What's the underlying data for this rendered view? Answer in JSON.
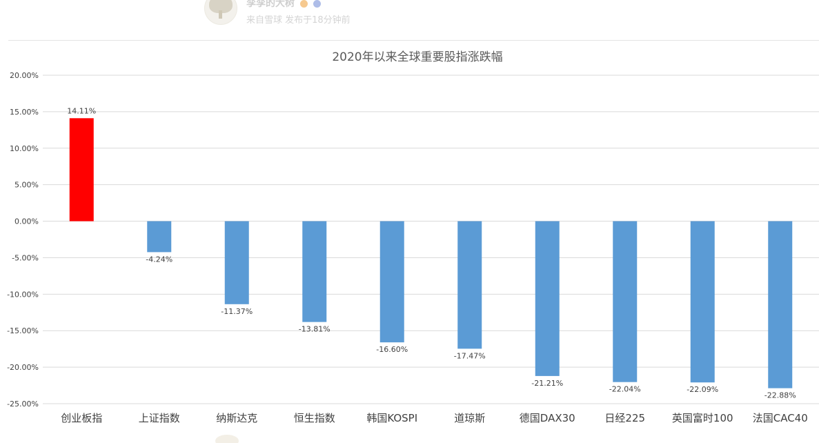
{
  "post": {
    "author": "孪孪的大树",
    "meta": "来自雪球 发布于18分钟前"
  },
  "chart_data": {
    "type": "bar",
    "title": "2020年以来全球重要股指涨跌幅",
    "xlabel": "",
    "ylabel": "",
    "categories": [
      "创业板指",
      "上证指数",
      "纳斯达克",
      "恒生指数",
      "韩国KOSPI",
      "道琼斯",
      "德国DAX30",
      "日经225",
      "英国富时100",
      "法国CAC40"
    ],
    "values": [
      14.11,
      -4.24,
      -11.37,
      -13.81,
      -16.6,
      -17.47,
      -21.21,
      -22.04,
      -22.09,
      -22.88
    ],
    "data_labels": [
      "14.11%",
      "-4.24%",
      "-11.37%",
      "-13.81%",
      "-16.60%",
      "-17.47%",
      "-21.21%",
      "-22.04%",
      "-22.09%",
      "-22.88%"
    ],
    "ylim": [
      -25,
      20
    ],
    "yticks": [
      20,
      15,
      10,
      5,
      0,
      -5,
      -10,
      -15,
      -20,
      -25
    ],
    "ytick_labels": [
      "20.00%",
      "15.00%",
      "10.00%",
      "5.00%",
      "0.00%",
      "-5.00%",
      "-10.00%",
      "-15.00%",
      "-20.00%",
      "-25.00%"
    ],
    "grid": true,
    "legend": "none",
    "colors": {
      "positive": "#ff0000",
      "negative": "#5b9bd5",
      "grid": "#d9d9d9",
      "text": "#404040",
      "title": "#595959"
    }
  }
}
